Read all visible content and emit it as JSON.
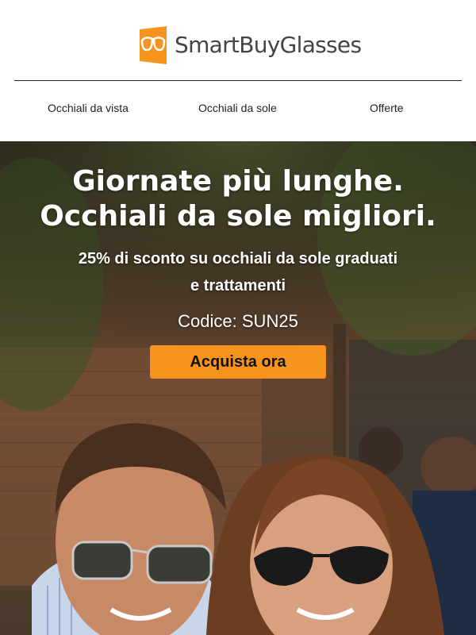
{
  "brand": {
    "name": "SmartBuyGlasses",
    "accent": "#f7941d"
  },
  "nav": {
    "items": [
      "Occhiali da vista",
      "Occhiali da sole",
      "Offerte"
    ]
  },
  "hero": {
    "headline_line1": "Giornate più lunghe.",
    "headline_line2": "Occhiali da sole migliori.",
    "subtitle_line1": "25% di sconto su occhiali da sole graduati",
    "subtitle_line2": "e trattamenti",
    "code": "Codice: SUN25",
    "cta": "Acquista ora"
  }
}
